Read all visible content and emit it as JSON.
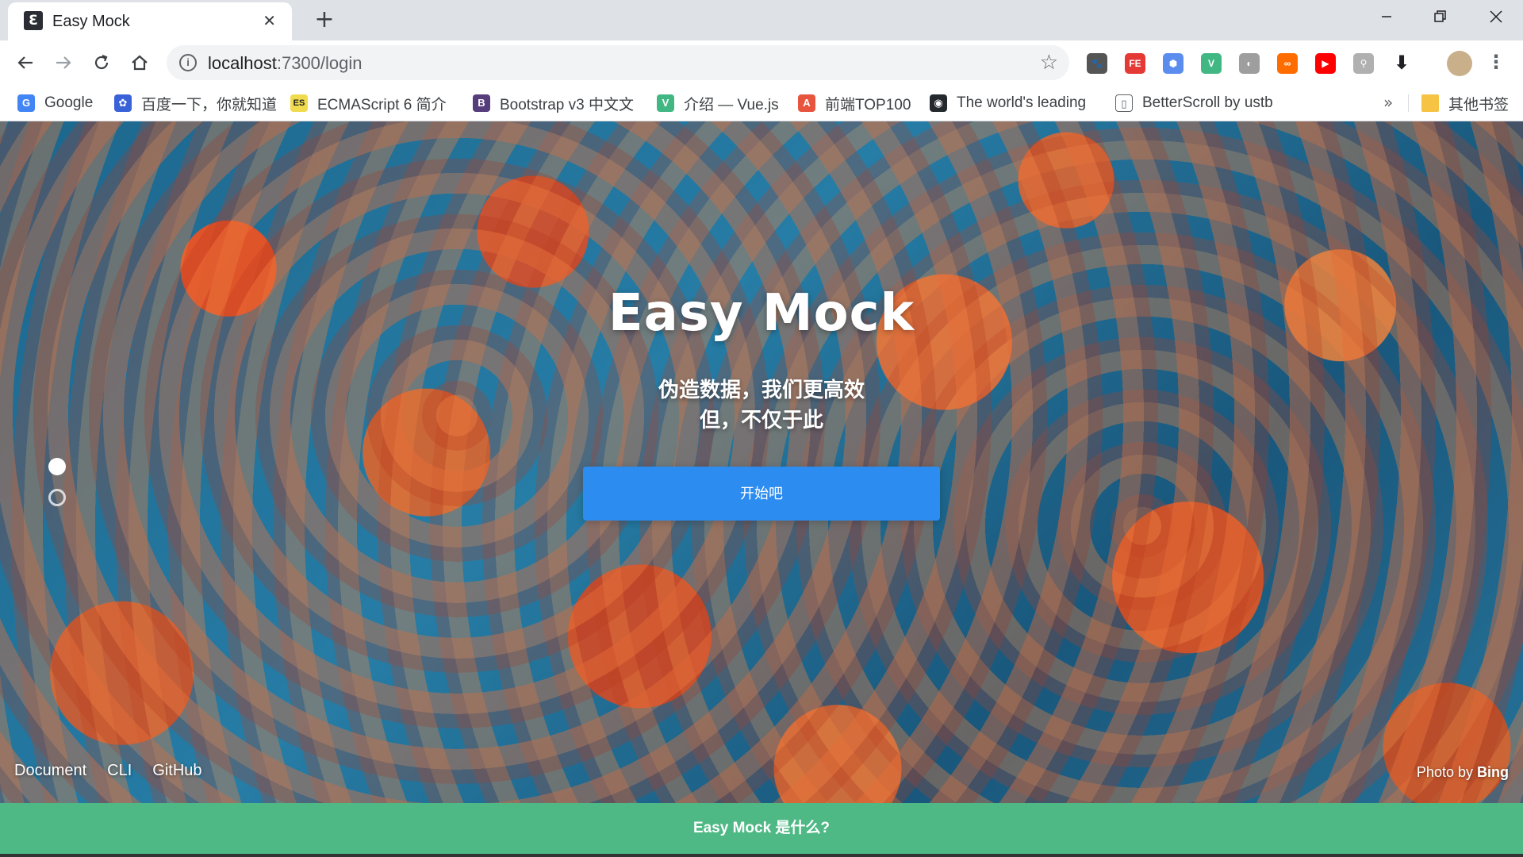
{
  "browser": {
    "tab": {
      "title": "Easy Mock",
      "favicon_glyph": "Ɛ"
    },
    "new_tab_glyph": "+",
    "window_controls": {
      "minimize": "—",
      "maximize": "❐",
      "close": "✕"
    },
    "address_bar": {
      "host": "localhost",
      "path": ":7300/login",
      "star_glyph": "☆"
    },
    "extensions": [
      {
        "name": "extension-cat-icon",
        "text": "🐾",
        "color": "#555555"
      },
      {
        "name": "extension-fe-icon",
        "text": "FE",
        "color": "#e53935"
      },
      {
        "name": "extension-hex-icon",
        "text": "⬢",
        "color": "#5b8def"
      },
      {
        "name": "extension-vue-devtools-icon",
        "text": "V",
        "color": "#41b883"
      },
      {
        "name": "extension-circle-icon",
        "text": "◐",
        "color": "#9e9e9e"
      },
      {
        "name": "extension-infinity-icon",
        "text": "∞",
        "color": "#ff6d00"
      },
      {
        "name": "extension-youtube-icon",
        "text": "▶",
        "color": "#ff0000"
      },
      {
        "name": "extension-tree-icon",
        "text": "⚲",
        "color": "#b0b0b0"
      },
      {
        "name": "extension-download-icon",
        "text": "⬇",
        "color": "#202124"
      }
    ],
    "menu_glyph": "⋮",
    "bookmarks": [
      {
        "label": "Google",
        "icon": "G",
        "color": "#4285f4"
      },
      {
        "label": "百度一下，你就知道",
        "icon": "✿",
        "color": "#3a62d8"
      },
      {
        "label": "ECMAScript 6 简介",
        "icon": "ES",
        "color": "#f0db4f"
      },
      {
        "label": "Bootstrap v3 中文文",
        "icon": "B",
        "color": "#563d7c"
      },
      {
        "label": "介绍 — Vue.js",
        "icon": "V",
        "color": "#41b883"
      },
      {
        "label": "前端TOP100",
        "icon": "A",
        "color": "#e8553f"
      },
      {
        "label": "The world's leading",
        "icon": "◉",
        "color": "#24292e"
      },
      {
        "label": "BetterScroll by ustb",
        "icon": "▯",
        "color": "#ffffff"
      }
    ],
    "bookmarks_more": "»",
    "other_bookmarks": {
      "label": "其他书签",
      "color": "#f6c343"
    }
  },
  "page": {
    "title": "Easy Mock",
    "subtitle_line1": "伪造数据，我们更高效",
    "subtitle_line2": "但，不仅于此",
    "start_button": "开始吧",
    "carousel": {
      "slides": 2,
      "active_index": 0
    },
    "footer_links": [
      "Document",
      "CLI",
      "GitHub"
    ],
    "photo_credit": {
      "prefix": "Photo by",
      "source": "Bing"
    },
    "what_is": "Easy Mock 是什么?"
  }
}
